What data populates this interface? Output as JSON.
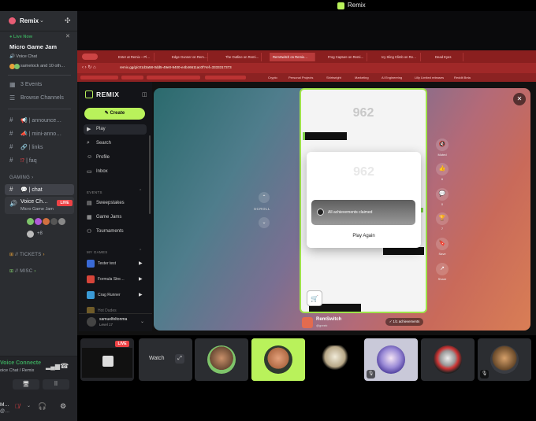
{
  "window": {
    "title": "Remix"
  },
  "server": {
    "name": "Remix"
  },
  "live_now": {
    "label": "Live Now",
    "event_name": "Micro Game Jam",
    "channel": "Voice Chat",
    "people": "sametock and 10 oth…"
  },
  "sidebar": {
    "events": "3 Events",
    "browse": "Browse Channels",
    "channels": [
      "| announce…",
      "| mini-anno…",
      "| links",
      "| faq"
    ],
    "gaming_category": "GAMING",
    "chat_channel": "| chat",
    "voice_channel": {
      "name": "Voice Ch…",
      "sub": "Micro Game Jam",
      "badge": "LIVE",
      "more": "+8"
    },
    "tickets": "// TICKETS",
    "misc": "// MISC"
  },
  "voice_panel": {
    "title": "Voice Connecte",
    "sub": "oice Chat / Remix"
  },
  "user_panel": {
    "name": "M…",
    "sub": "@…"
  },
  "browser": {
    "tabs": [
      "Enter at Remix – Pl…",
      "Edge Gunner on Rem…",
      "The Outline on Remi…",
      "RemSwitch on Remix…",
      "Frog Capture on Remi…",
      "Icy Sling Climb on Re…",
      "Dead Eyes"
    ],
    "url": "remix.gg/g/c01d3a58-0dd5-49e0-9400-e4b46611ac0f?ref=3333317373",
    "bookmarks": [
      "Crypto",
      "Personal Projects",
      "Shirtwright",
      "Marketing",
      "AI Engineering",
      "Lilly Limited releases",
      "Reddit Beta"
    ]
  },
  "remix": {
    "logo": "REMIX",
    "create_label": "Create",
    "nav": [
      "Play",
      "Search",
      "Profile",
      "Inbox"
    ],
    "events_cat": "EVENTS",
    "events": [
      "Sweepstakes",
      "Game Jams",
      "Tournaments"
    ],
    "games_cat": "MY GAMES",
    "games": [
      "Tester test",
      "Formula Stre…",
      "Crag Runner",
      "Hot Dudes"
    ],
    "user": {
      "name": "samuelfeltonma",
      "level": "Level 17"
    },
    "scroll_label": "SCROLL",
    "game": {
      "score": "962",
      "modal_score": "962",
      "achievement": "All achievements claimed",
      "play_again": "Play Again"
    },
    "rail": [
      {
        "icon": "🔇",
        "label": "Muted"
      },
      {
        "icon": "👍",
        "label": "6"
      },
      {
        "icon": "💬",
        "label": "0"
      },
      {
        "icon": "🏆",
        "label": "7"
      },
      {
        "icon": "🔖",
        "label": "Save"
      },
      {
        "icon": "↗",
        "label": "Share"
      }
    ],
    "creator": {
      "name": "RemSwitch",
      "handle": "@greeb"
    },
    "achievements_pill": "1/1 achievements"
  },
  "strip": {
    "watch": "Watch",
    "live": "LIVE"
  },
  "colors": {
    "accent": "#b9f25b",
    "live": "#ed4245",
    "online": "#3ba55c"
  }
}
